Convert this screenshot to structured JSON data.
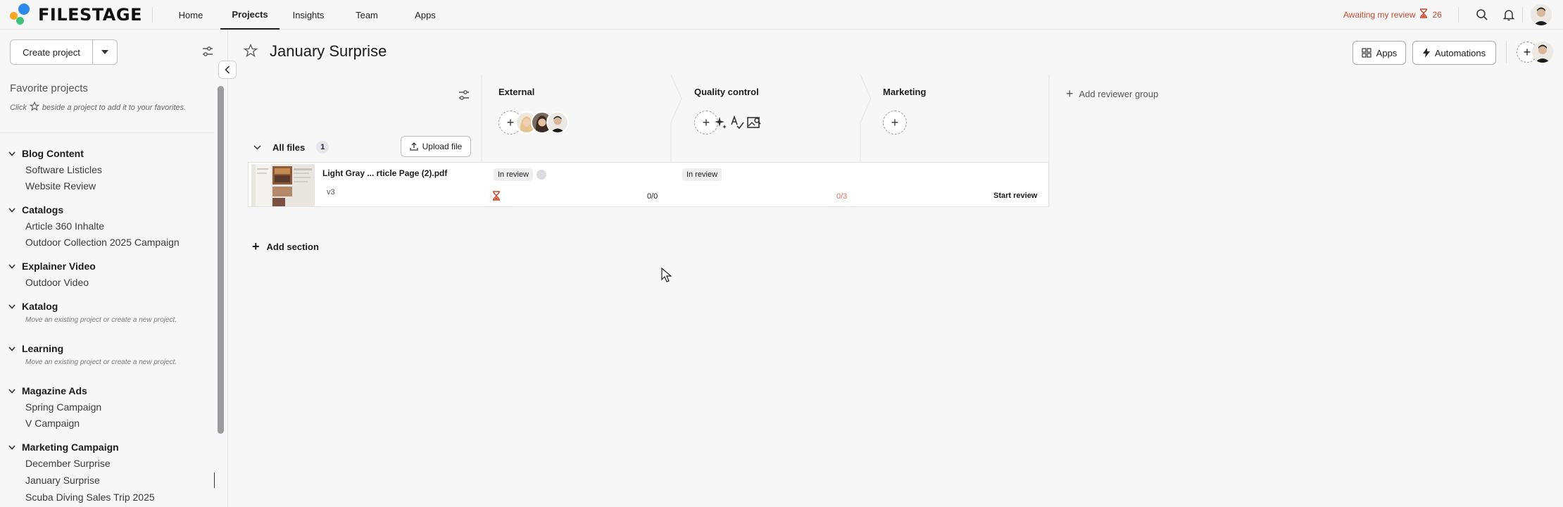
{
  "brand": {
    "name": "FILESTAGE"
  },
  "nav": {
    "home": "Home",
    "projects": "Projects",
    "insights": "Insights",
    "team": "Team",
    "apps": "Apps"
  },
  "awaiting": {
    "label": "Awaiting my review",
    "count": "26"
  },
  "sidebar": {
    "create_label": "Create project",
    "favorites_title": "Favorite projects",
    "favorites_hint_pre": "Click",
    "favorites_hint_post": "beside a project to add it to your favorites.",
    "groups": [
      {
        "name": "Blog Content",
        "items": [
          "Software Listicles",
          "Website Review"
        ]
      },
      {
        "name": "Catalogs",
        "items": [
          "Article 360 Inhalte",
          "Outdoor Collection 2025 Campaign"
        ]
      },
      {
        "name": "Explainer Video",
        "items": [
          "Outdoor Video"
        ]
      },
      {
        "name": "Katalog",
        "hint": "Move an existing project or create a new project."
      },
      {
        "name": "Learning",
        "hint": "Move an existing project or create a new project."
      },
      {
        "name": "Magazine Ads",
        "items": [
          "Spring Campaign",
          "V Campaign"
        ]
      },
      {
        "name": "Marketing Campaign",
        "items": [
          "December Surprise",
          "January Surprise",
          "Scuba Diving Sales Trip 2025"
        ]
      }
    ]
  },
  "project": {
    "title": "January Surprise"
  },
  "header_buttons": {
    "apps": "Apps",
    "automations": "Automations"
  },
  "board": {
    "columns": [
      "External",
      "Quality control",
      "Marketing"
    ],
    "add_reviewer_group": "Add reviewer group",
    "section_title": "All files",
    "file_count": "1",
    "upload_label": "Upload file",
    "add_section": "Add section"
  },
  "file": {
    "name": "Light Gray ...  rticle Page (2).pdf",
    "version": "v3",
    "external_status": "In review",
    "external_ratio": "0/0",
    "qc_status": "In review",
    "qc_ratio": "0/3",
    "marketing_action": "Start review"
  },
  "colors": {
    "accent_red": "#c8472b",
    "logo_blue": "#2c8be8",
    "logo_orange": "#f5a623",
    "logo_green": "#3cc47c"
  }
}
